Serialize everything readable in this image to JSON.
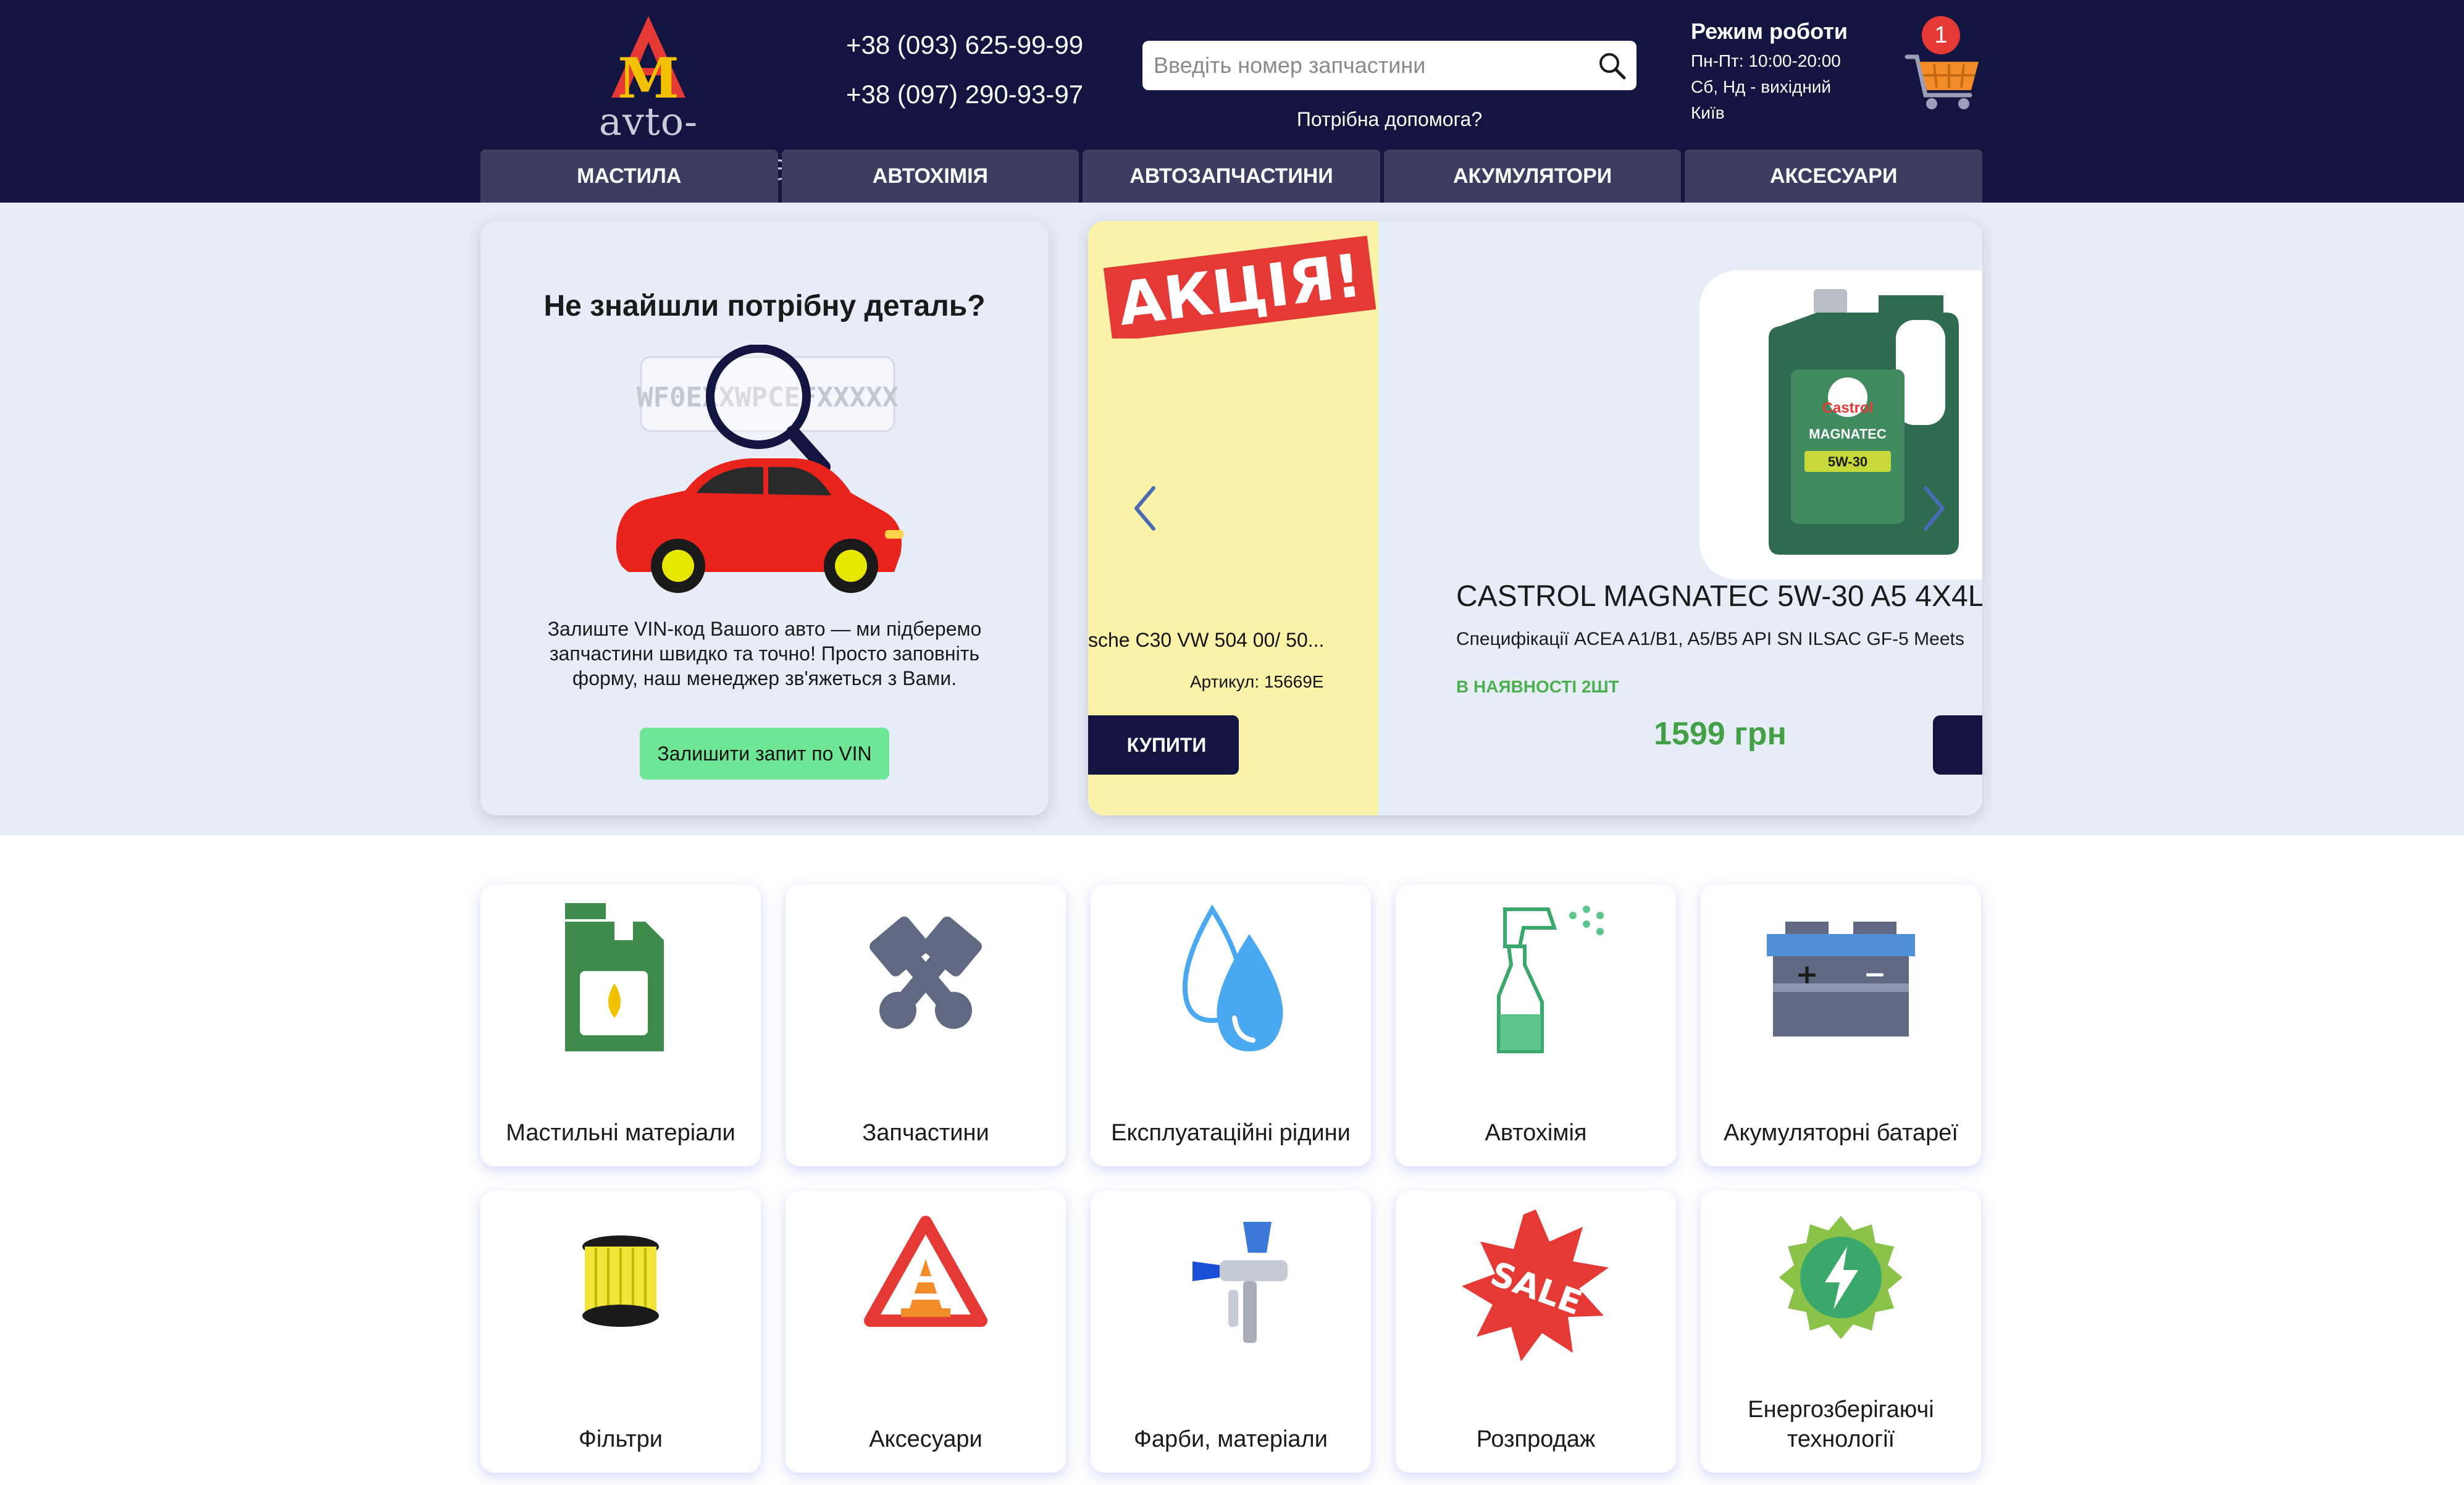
{
  "header": {
    "logo_text": "avto-magaz.com.ua",
    "logo_letters": "AM",
    "phones": [
      "+38 (093) 625-99-99",
      "+38 (097) 290-93-97"
    ],
    "search_placeholder": "Введіть номер запчастини",
    "help_text": "Потрібна допомога?",
    "hours": {
      "title": "Режим роботи",
      "lines": [
        "Пн-Пт: 10:00-20:00",
        "Сб, Нд - вихідний",
        "Київ"
      ]
    },
    "cart_count": "1"
  },
  "nav": [
    "МАСТИЛА",
    "АВТОХІМІЯ",
    "АВТОЗАПЧАСТИНИ",
    "АКУМУЛЯТОРИ",
    "АКСЕСУАРИ"
  ],
  "vin": {
    "title": "Не знайшли потрібну деталь?",
    "sample_vin": "WF0EXXWPCEFXXXXX",
    "text": "Залиште VIN-код Вашого авто — ми підберемо запчастини швидко та точно! Просто заповніть форму, наш менеджер зв'яжеться з Вами.",
    "button": "Залишити запит по VIN"
  },
  "slider": {
    "promo_label": "АКЦІЯ!",
    "prev_slide": {
      "name": "sche C30 VW 504 00/ 50...",
      "article": "Артикул: 15669E",
      "buy": "КУПИТИ"
    },
    "product": {
      "brand_label": "Castrol",
      "line_label": "MAGNATEC",
      "grade_label": "5W-30",
      "name": "CASTROL MAGNATEC 5W-30 A5 4X4L",
      "spec": "Специфікації ACEA A1/B1, A5/B5 API SN ILSAC GF-5 Meets",
      "stock": "В НАЯВНОСТІ 2ШТ",
      "price": "1599 грн"
    }
  },
  "categories": [
    {
      "label": "Мастильні матеріали",
      "icon": "oil-canister-icon"
    },
    {
      "label": "Запчастини",
      "icon": "pistons-icon"
    },
    {
      "label": "Експлуатаційні рідини",
      "icon": "fluid-drops-icon"
    },
    {
      "label": "Автохімія",
      "icon": "spray-bottle-icon"
    },
    {
      "label": "Акумуляторні батареї",
      "icon": "battery-icon"
    },
    {
      "label": "Фільтри",
      "icon": "filter-icon"
    },
    {
      "label": "Аксесуари",
      "icon": "warning-triangle-icon"
    },
    {
      "label": "Фарби, матеріали",
      "icon": "spray-gun-icon"
    },
    {
      "label": "Розпродаж",
      "icon": "sale-badge-icon"
    },
    {
      "label": "Енергозберігаючі технології",
      "icon": "energy-icon"
    }
  ],
  "colors": {
    "header_bg": "#12153f",
    "nav_bg": "#3b3e61",
    "hero_bg": "#e7edf7",
    "accent_green": "#43a047",
    "vin_button": "#6ee695",
    "promo_red": "#e53935"
  }
}
